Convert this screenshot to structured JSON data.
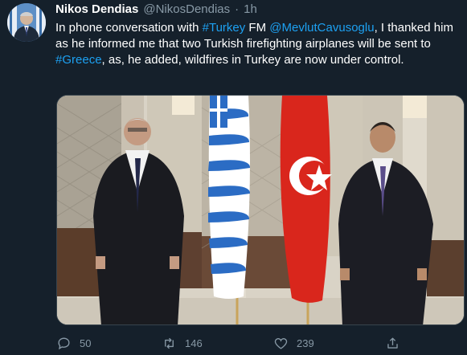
{
  "tweet": {
    "author_name": "Nikos Dendias",
    "author_handle": "@NikosDendias",
    "separator": "·",
    "time": "1h",
    "text_parts": [
      {
        "t": "In phone conversation with ",
        "link": false
      },
      {
        "t": "#Turkey",
        "link": true
      },
      {
        "t": " FM ",
        "link": false
      },
      {
        "t": "@MevlutCavusoglu",
        "link": true
      },
      {
        "t": ", I thanked him as he informed me that two Turkish firefighting airplanes will be sent to ",
        "link": false
      },
      {
        "t": "#Greece",
        "link": true
      },
      {
        "t": ", as, he added, wildfires in Turkey are now under control.",
        "link": false
      }
    ]
  },
  "actions": {
    "reply_count": "50",
    "retweet_count": "146",
    "like_count": "239"
  },
  "colors": {
    "background": "#15202b",
    "link": "#1da1f2",
    "secondary_text": "#8899a6"
  },
  "icons": [
    "reply-icon",
    "retweet-icon",
    "like-icon",
    "share-icon"
  ]
}
